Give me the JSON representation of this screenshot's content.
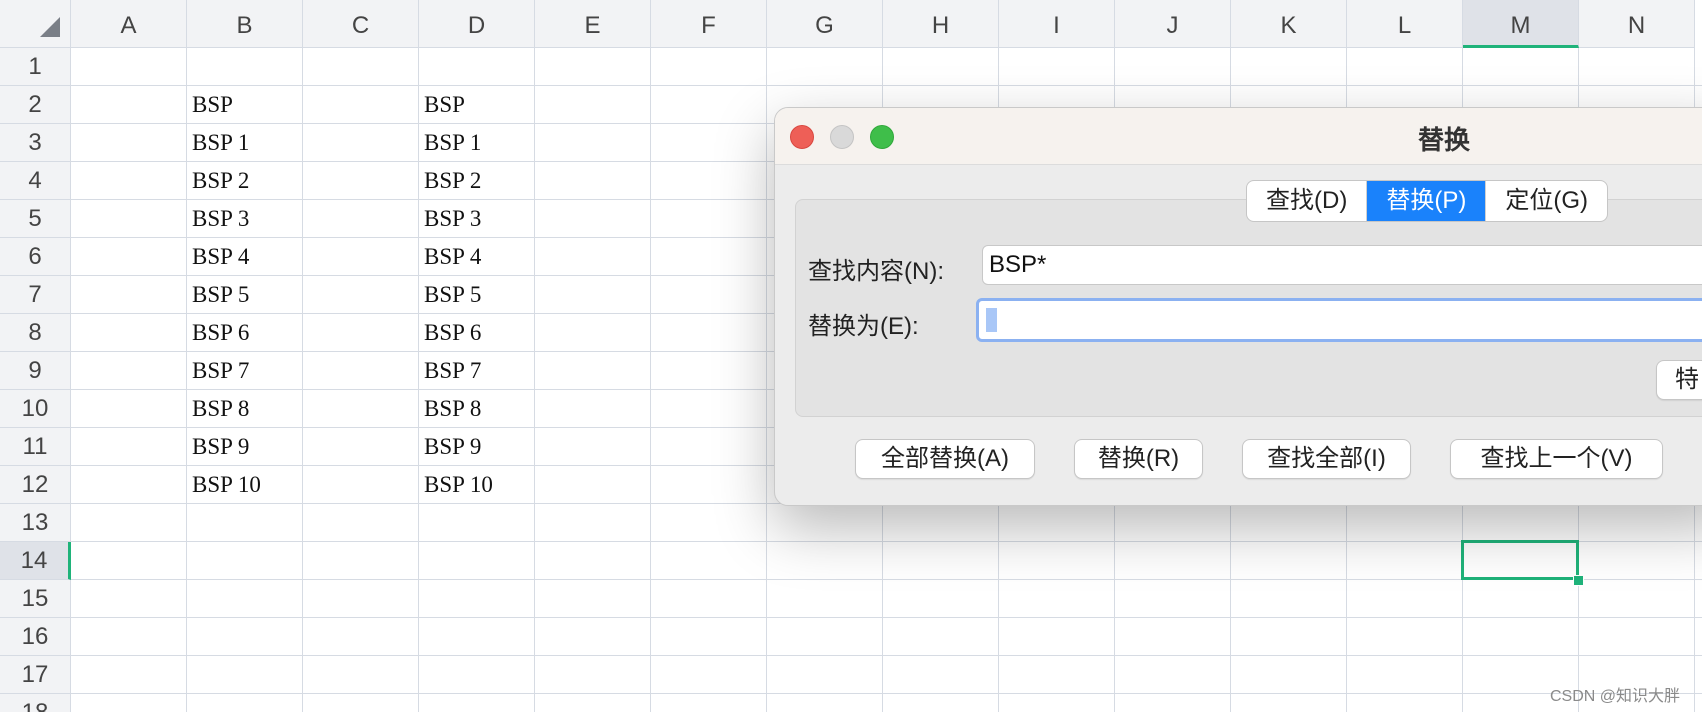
{
  "columns": [
    "A",
    "B",
    "C",
    "D",
    "E",
    "F",
    "G",
    "H",
    "I",
    "J",
    "K",
    "L",
    "M",
    "N"
  ],
  "selected_column": "M",
  "rows": [
    "1",
    "2",
    "3",
    "4",
    "5",
    "6",
    "7",
    "8",
    "9",
    "10",
    "11",
    "12",
    "13",
    "14",
    "15",
    "16",
    "17",
    "18"
  ],
  "selected_row": "14",
  "column_b_values": [
    "BSP",
    "BSP 1",
    "BSP 2",
    "BSP 3",
    "BSP 4",
    "BSP 5",
    "BSP 6",
    "BSP 7",
    "BSP 8",
    "BSP 9",
    "BSP 10"
  ],
  "column_d_values": [
    "BSP",
    "BSP 1",
    "BSP 2",
    "BSP 3",
    "BSP 4",
    "BSP 5",
    "BSP 6",
    "BSP 7",
    "BSP 8",
    "BSP 9",
    "BSP 10"
  ],
  "dialog": {
    "title": "替换",
    "tabs": [
      {
        "label": "查找(D)",
        "active": false
      },
      {
        "label": "替换(P)",
        "active": true
      },
      {
        "label": "定位(G)",
        "active": false
      }
    ],
    "find_label": "查找内容(N):",
    "find_value": "BSP*",
    "replace_label": "替换为(E):",
    "replace_value": "",
    "special_button_partial": "特",
    "buttons": {
      "replace_all": "全部替换(A)",
      "replace": "替换(R)",
      "find_all": "查找全部(I)",
      "find_prev": "查找上一个(V)"
    }
  },
  "watermark": "CSDN @知识大胖",
  "colors": {
    "accent_green": "#1fb37a",
    "tab_active_blue": "#1a82fb",
    "close": "#ee5f57",
    "minimize": "#d9d9d9",
    "zoom": "#3fbe4a"
  }
}
